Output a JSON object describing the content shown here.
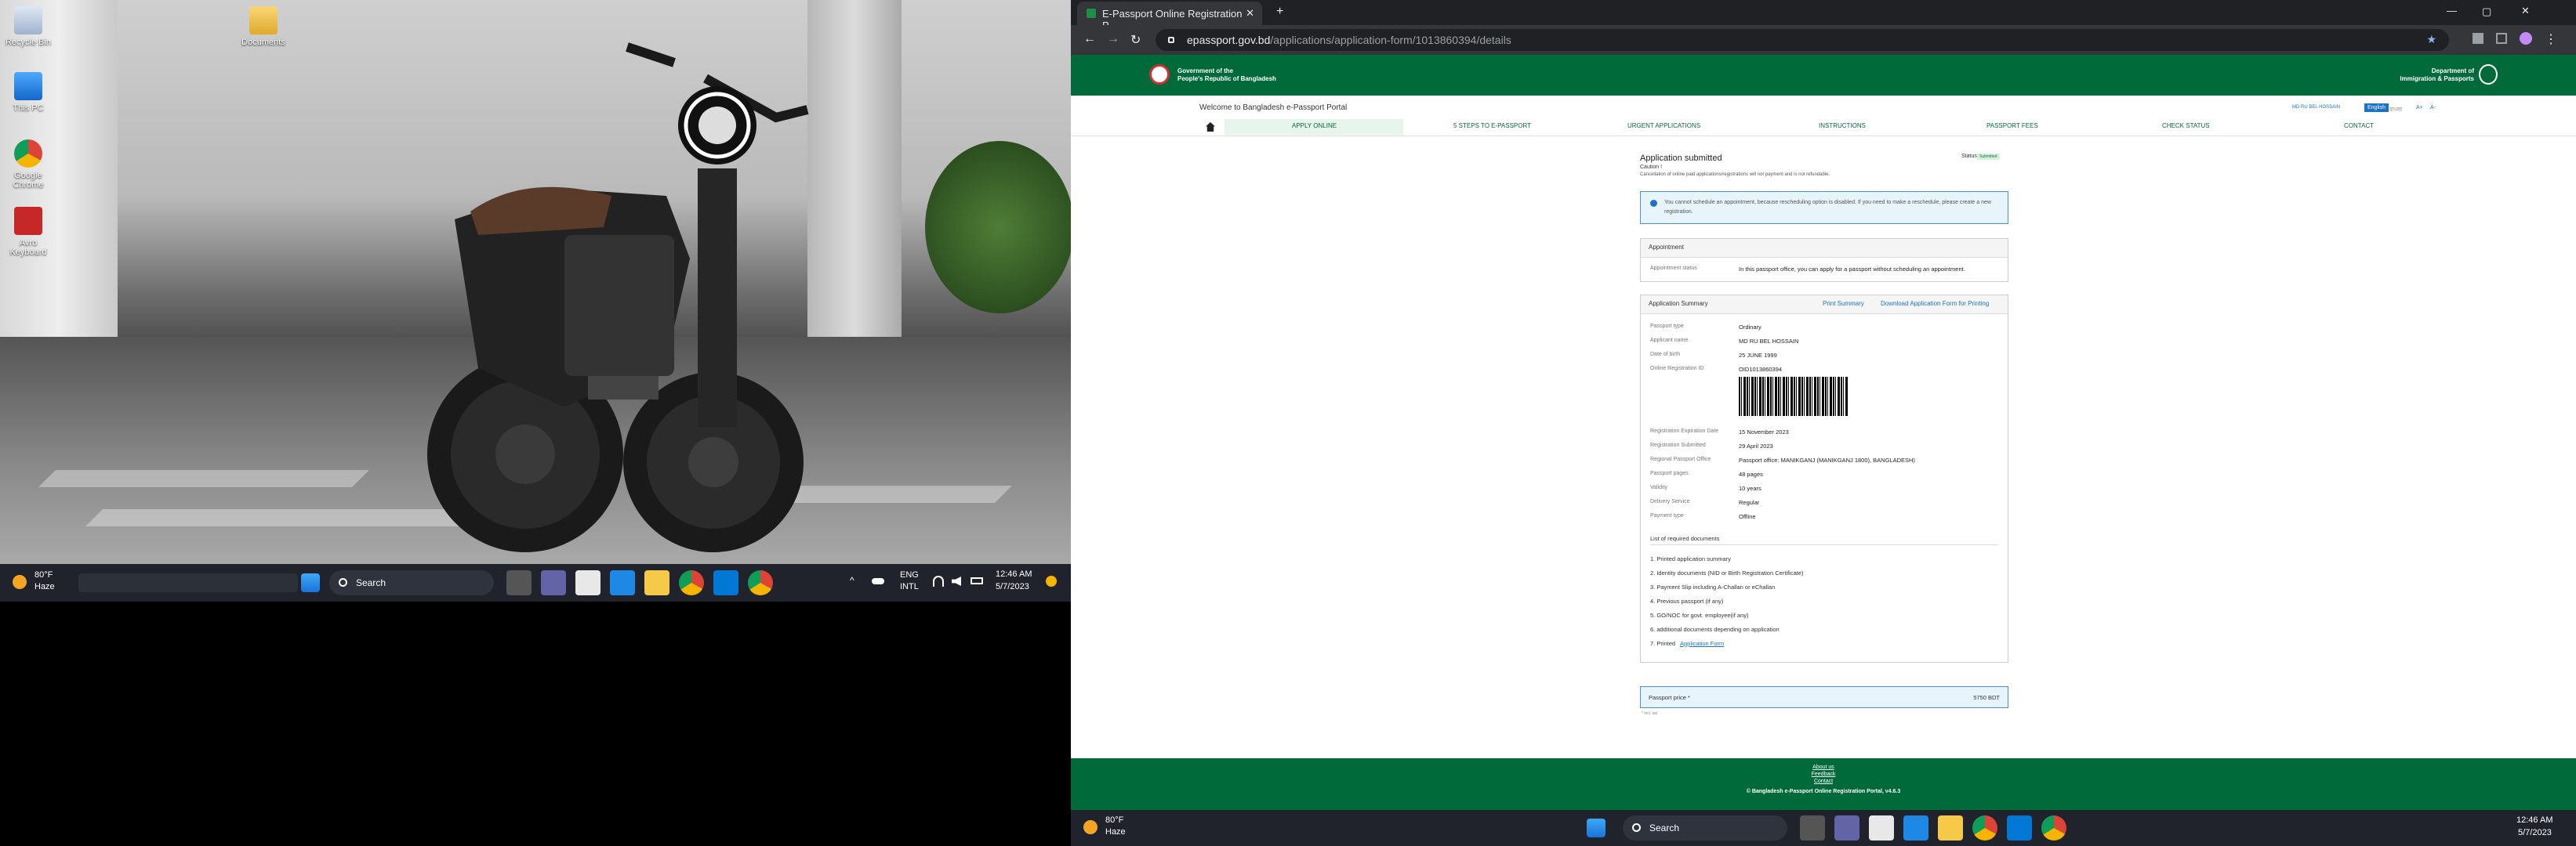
{
  "left_desktop": {
    "icons": [
      {
        "label": "Recycle Bin",
        "icon": "recycle-bin-icon"
      },
      {
        "label": "Documents",
        "icon": "folder-icon"
      },
      {
        "label": "This PC",
        "icon": "pc-icon"
      },
      {
        "label": "Google Chrome",
        "icon": "chrome-icon"
      },
      {
        "label": "Avro Keyboard",
        "icon": "keyboard-icon"
      }
    ],
    "taskbar": {
      "weather_temp": "80°F",
      "weather_desc": "Haze",
      "search_placeholder": "Search",
      "lang": "ENG",
      "lang_sub": "INTL",
      "time": "12:46 AM",
      "date": "5/7/2023"
    }
  },
  "browser": {
    "tab_title": "E-Passport Online Registration P...",
    "url_domain": "epassport.gov.bd",
    "url_path": "/applications/application-form/1013860394/details",
    "header": {
      "gov_line1": "Government of the",
      "gov_line2": "People's Republic of Bangladesh",
      "dept_line1": "Department of",
      "dept_line2": "Immigration & Passports"
    },
    "welcome": "Welcome to Bangladesh e-Passport Portal",
    "user_name": "MD RU BEL HOSSAIN",
    "lang_en": "English",
    "lang_bn": "বাংলা",
    "font_inc": "A+",
    "font_dec": "A-",
    "nav": [
      "APPLY ONLINE",
      "5 STEPS TO e-PASSPORT",
      "URGENT APPLICATIONS",
      "INSTRUCTIONS",
      "PASSPORT FEES",
      "CHECK STATUS",
      "CONTACT"
    ],
    "page": {
      "title": "Application submitted",
      "status_label": "Status",
      "status_value": "Submitted",
      "caution_title": "Caution !",
      "caution_text": "Cancellation of online paid applications/registrations will not payment and is not refundable.",
      "notice": "You cannot schedule an appointment, because rescheduling option is disabled. If you need to make a reschedule, please create a new registration.",
      "appointment_head": "Appointment",
      "appointment_status_key": "Appointment status",
      "appointment_status_val": "In this passport office, you can apply for a passport without scheduling an appointment.",
      "summary_head": "Application Summary",
      "print_summary": "Print Summary",
      "download_form": "Download Application Form for Printing",
      "summary_rows": [
        {
          "k": "Passport type",
          "v": "Ordinary"
        },
        {
          "k": "Applicant name",
          "v": "MD RU BEL HOSSAIN"
        },
        {
          "k": "Date of birth",
          "v": "25 JUNE 1999"
        },
        {
          "k": "Online Registration ID",
          "v": "OID1013860394"
        }
      ],
      "detail_rows": [
        {
          "k": "Registration Expiration Date",
          "v": "15 November 2023"
        },
        {
          "k": "Registration Submitted",
          "v": "29 April 2023"
        },
        {
          "k": "Regional Passport Office",
          "v": "Passport office: MANIKGANJ (MANIKGANJ 1800), BANGLADESH)"
        },
        {
          "k": "Passport pages",
          "v": "48 pages"
        },
        {
          "k": "Validity",
          "v": "10 years"
        },
        {
          "k": "Delivery Service",
          "v": "Regular"
        },
        {
          "k": "Payment type",
          "v": "Offline"
        }
      ],
      "docs_head": "List of required documents",
      "docs": [
        "1. Printed application summary",
        "2. Identity documents (NID or Birth Registration Certificate)",
        "3. Payment Slip including A-Challan or eChallan",
        "4. Previous passport (if any)",
        "5. GO/NOC for govt. employee(if any)",
        "6. additional documents depending on application",
        "7. Printed"
      ],
      "docs_link": "Application Form",
      "price_label": "Passport price *",
      "price_value": "5750 BDT",
      "price_note": "* incl. tax"
    },
    "footer": [
      "About us",
      "Feedback",
      "Contact",
      "© Bangladesh e-Passport Online Registration Portal, v4.6.3"
    ],
    "taskbar": {
      "weather_temp": "80°F",
      "weather_desc": "Haze",
      "search_placeholder": "Search",
      "time": "12:46 AM",
      "date": "5/7/2023"
    }
  },
  "colors": {
    "gov_green": "#006a3a",
    "accent_blue": "#1a73c8",
    "notice_bg": "#e8f4fb"
  }
}
